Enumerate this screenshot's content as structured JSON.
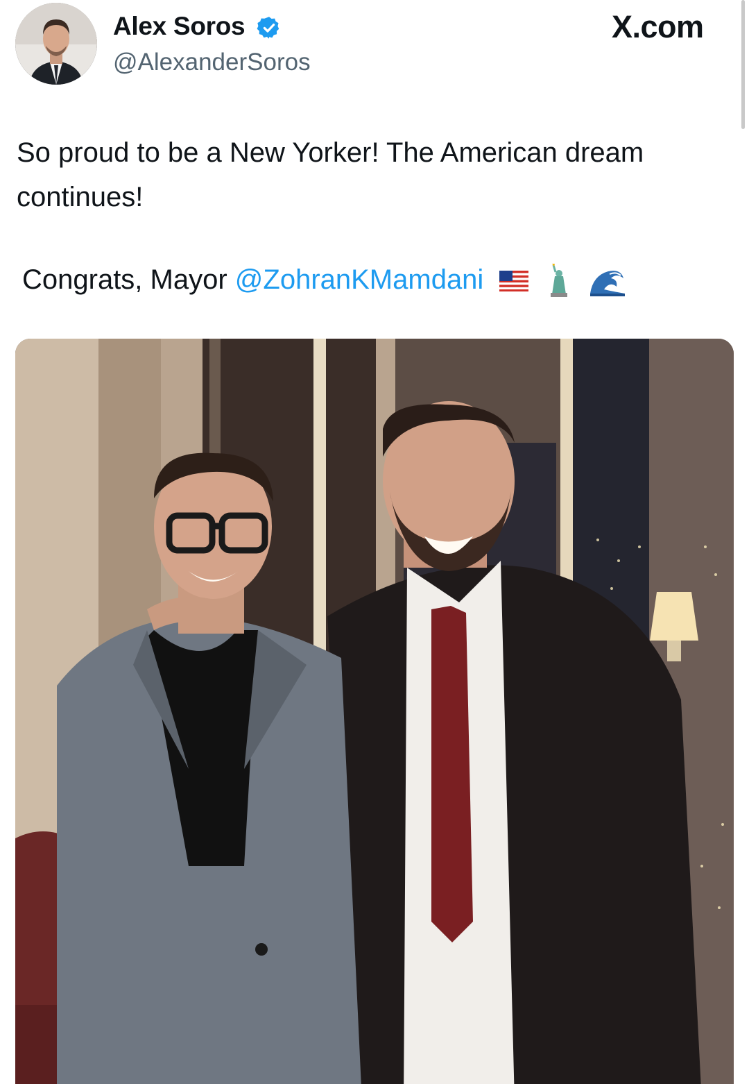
{
  "tweet": {
    "author_name": "Alex Soros",
    "handle": "@AlexanderSoros",
    "brand": "X.com",
    "text": "So proud to be a New Yorker! The American dream continues!",
    "congrats_prefix": "Congrats, Mayor ",
    "mention": "@ZohranKMamdani",
    "emojis": [
      "us-flag-icon",
      "statue-of-liberty-icon",
      "wave-icon"
    ]
  },
  "colors": {
    "verified_badge": "#1d9bf0",
    "mention": "#1d9bf0",
    "handle": "#536471"
  }
}
